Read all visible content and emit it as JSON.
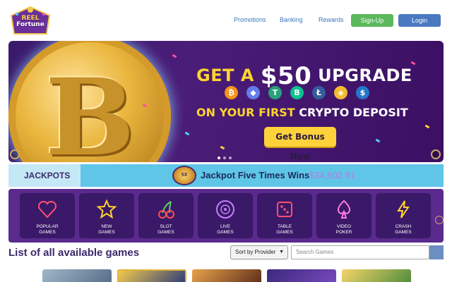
{
  "header": {
    "logo_line1": "REEL",
    "logo_line2": "Fortune",
    "nav": [
      "Promotions",
      "Banking",
      "Rewards"
    ],
    "signup_label": "Sign-Up",
    "login_label": "Login"
  },
  "hero": {
    "title_prefix": "GET A",
    "amount": "$50",
    "title_suffix": "UPGRADE",
    "sub_prefix": "ON YOUR FIRST",
    "sub_suffix": "CRYPTO DEPOSIT",
    "button_label": "Get Bonus Now",
    "crypto_icons": [
      "bitcoin-icon",
      "ethereum-icon",
      "tether-icon",
      "bitcoin-cash-icon",
      "litecoin-icon",
      "binance-icon",
      "usd-coin-icon"
    ]
  },
  "jackpot": {
    "label": "JACKPOTS",
    "badge": "5X",
    "text": "Jackpot Five Times Wins",
    "amount": "$34,602.91"
  },
  "categories": [
    {
      "label1": "POPULAR",
      "label2": "GAMES",
      "icon": "heart-icon"
    },
    {
      "label1": "NEW",
      "label2": "GAMES",
      "icon": "star-icon"
    },
    {
      "label1": "SLOT",
      "label2": "GAMES",
      "icon": "cherry-icon"
    },
    {
      "label1": "LIVE",
      "label2": "GAMES",
      "icon": "roulette-icon"
    },
    {
      "label1": "TABLE",
      "label2": "GAMES",
      "icon": "dice-icon"
    },
    {
      "label1": "VIDEO",
      "label2": "POKER",
      "icon": "spade-icon"
    },
    {
      "label1": "CRASH",
      "label2": "GAMES",
      "icon": "lightning-icon"
    }
  ],
  "games": {
    "title": "List of all available games",
    "sort_value": "Sort by Provider",
    "search_placeholder": "Search Games"
  },
  "colors": {
    "accent_green": "#5cb85c",
    "accent_blue": "#4a79c0",
    "purple": "#5a2a8c",
    "jackpot_blue": "#5fc6e8"
  }
}
